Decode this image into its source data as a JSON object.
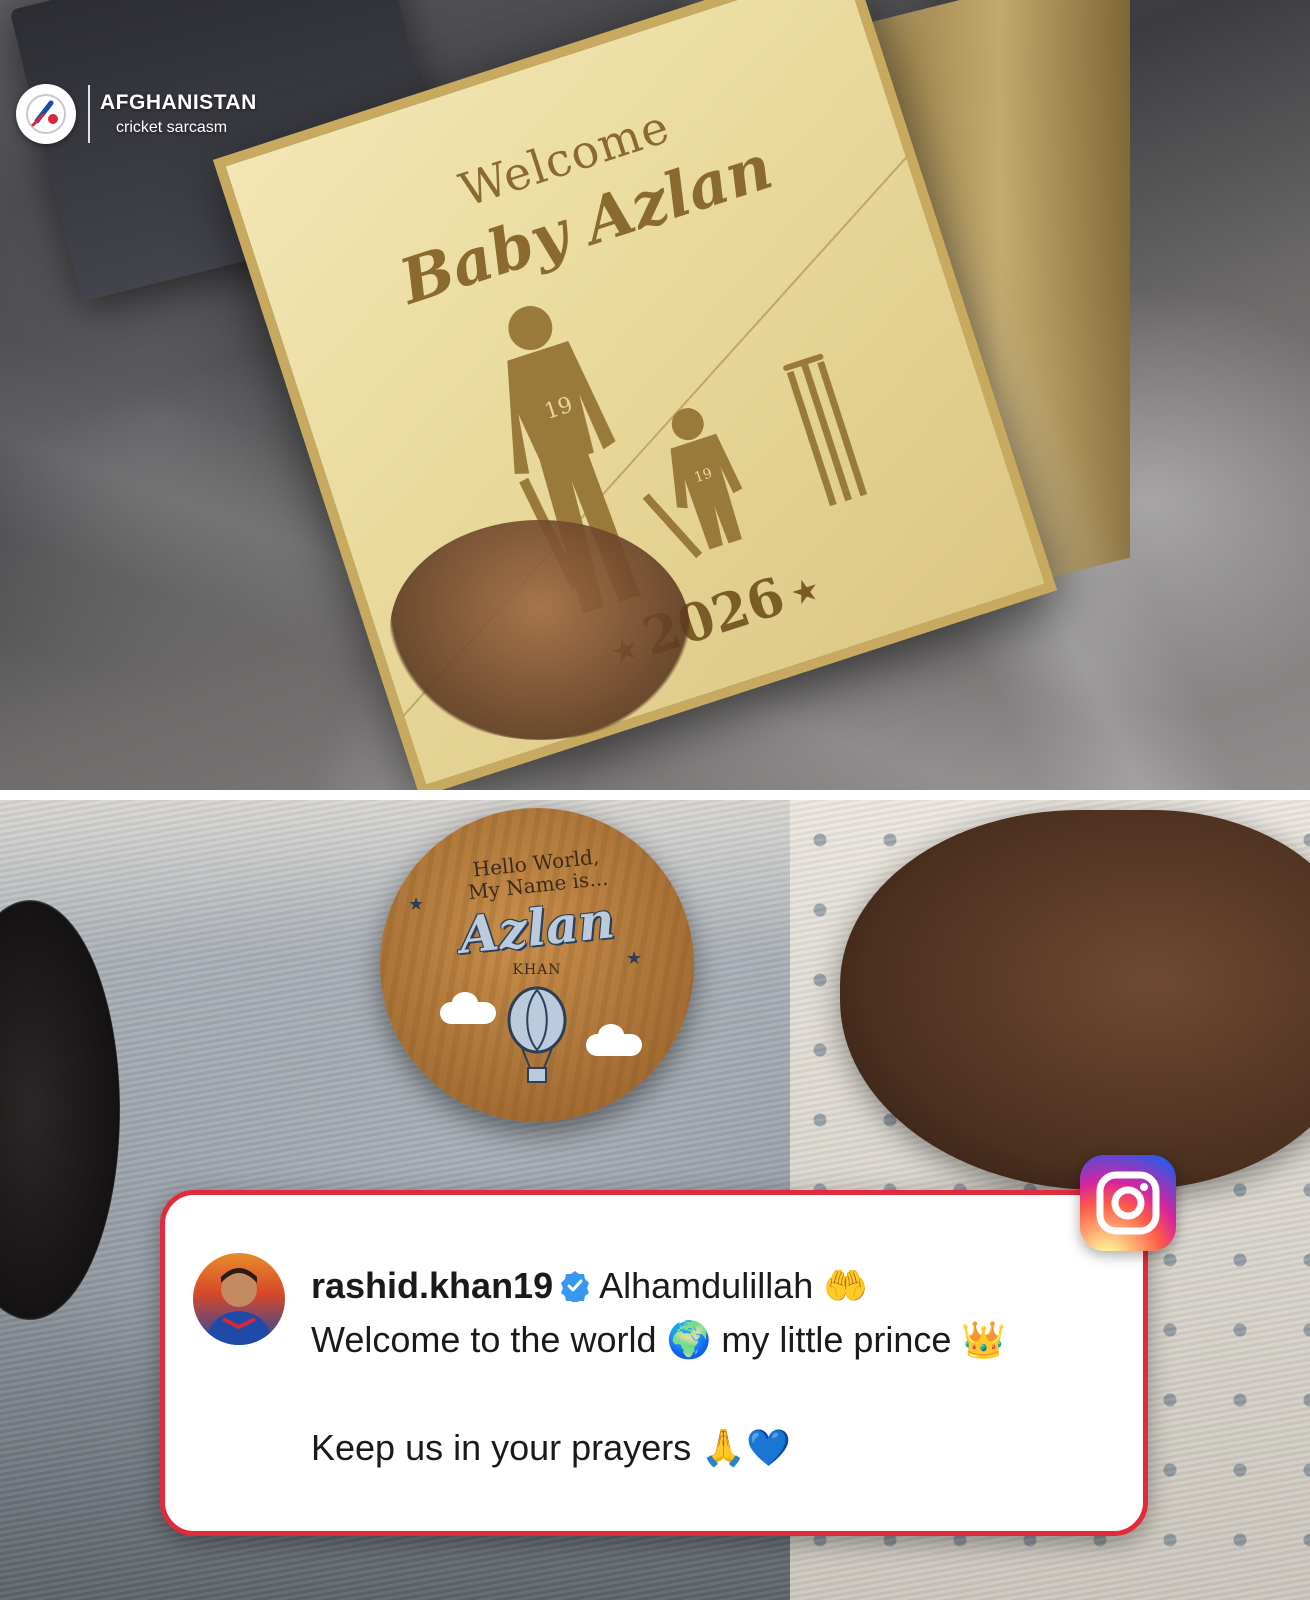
{
  "watermark": {
    "title": "AFGHANISTAN",
    "subtitle": "cricket sarcasm"
  },
  "plaque": {
    "welcome": "Welcome",
    "name": "Baby Azlan",
    "jersey_number": "19",
    "year": "2026"
  },
  "badge": {
    "greeting_line1": "Hello World,",
    "greeting_line2": "My Name is...",
    "name": "Azlan",
    "surname": "KHAN"
  },
  "post": {
    "platform_icon": "instagram-icon",
    "username": "rashid.khan19",
    "verified": true,
    "line1_text": "Alhamdulillah",
    "line1_emoji": "🤲",
    "line2_text_a": "Welcome to the world",
    "line2_emoji_a": "🌍",
    "line2_text_b": "my little prince",
    "line2_emoji_b": "👑",
    "line3_text": "Keep us in your prayers",
    "line3_emoji_a": "🙏",
    "line3_emoji_b": "💙"
  },
  "colors": {
    "card_border": "#e12a3c",
    "verified_blue": "#3897f0",
    "plaque_gold": "#e9d99c"
  }
}
